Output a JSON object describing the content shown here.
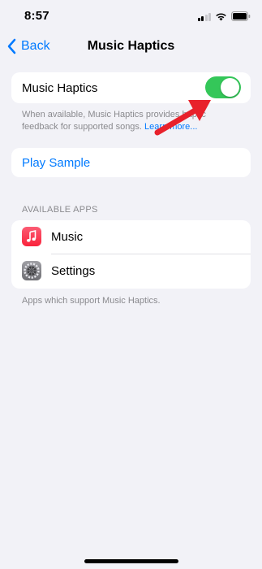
{
  "status_bar": {
    "time": "8:57"
  },
  "nav": {
    "back_label": "Back",
    "title": "Music Haptics"
  },
  "toggle_section": {
    "label": "Music Haptics",
    "enabled": true,
    "footnote_text": "When available, Music Haptics provides haptic feedback for supported songs.",
    "footnote_link": "Learn more..."
  },
  "sample": {
    "label": "Play Sample"
  },
  "apps_section": {
    "header": "AVAILABLE APPS",
    "items": [
      {
        "label": "Music",
        "icon": "music-icon"
      },
      {
        "label": "Settings",
        "icon": "settings-gear-icon"
      }
    ],
    "footnote": "Apps which support Music Haptics."
  },
  "colors": {
    "accent": "#007aff",
    "toggle_on": "#34c759",
    "annotation_arrow": "#e8212b",
    "background": "#f2f2f7"
  }
}
